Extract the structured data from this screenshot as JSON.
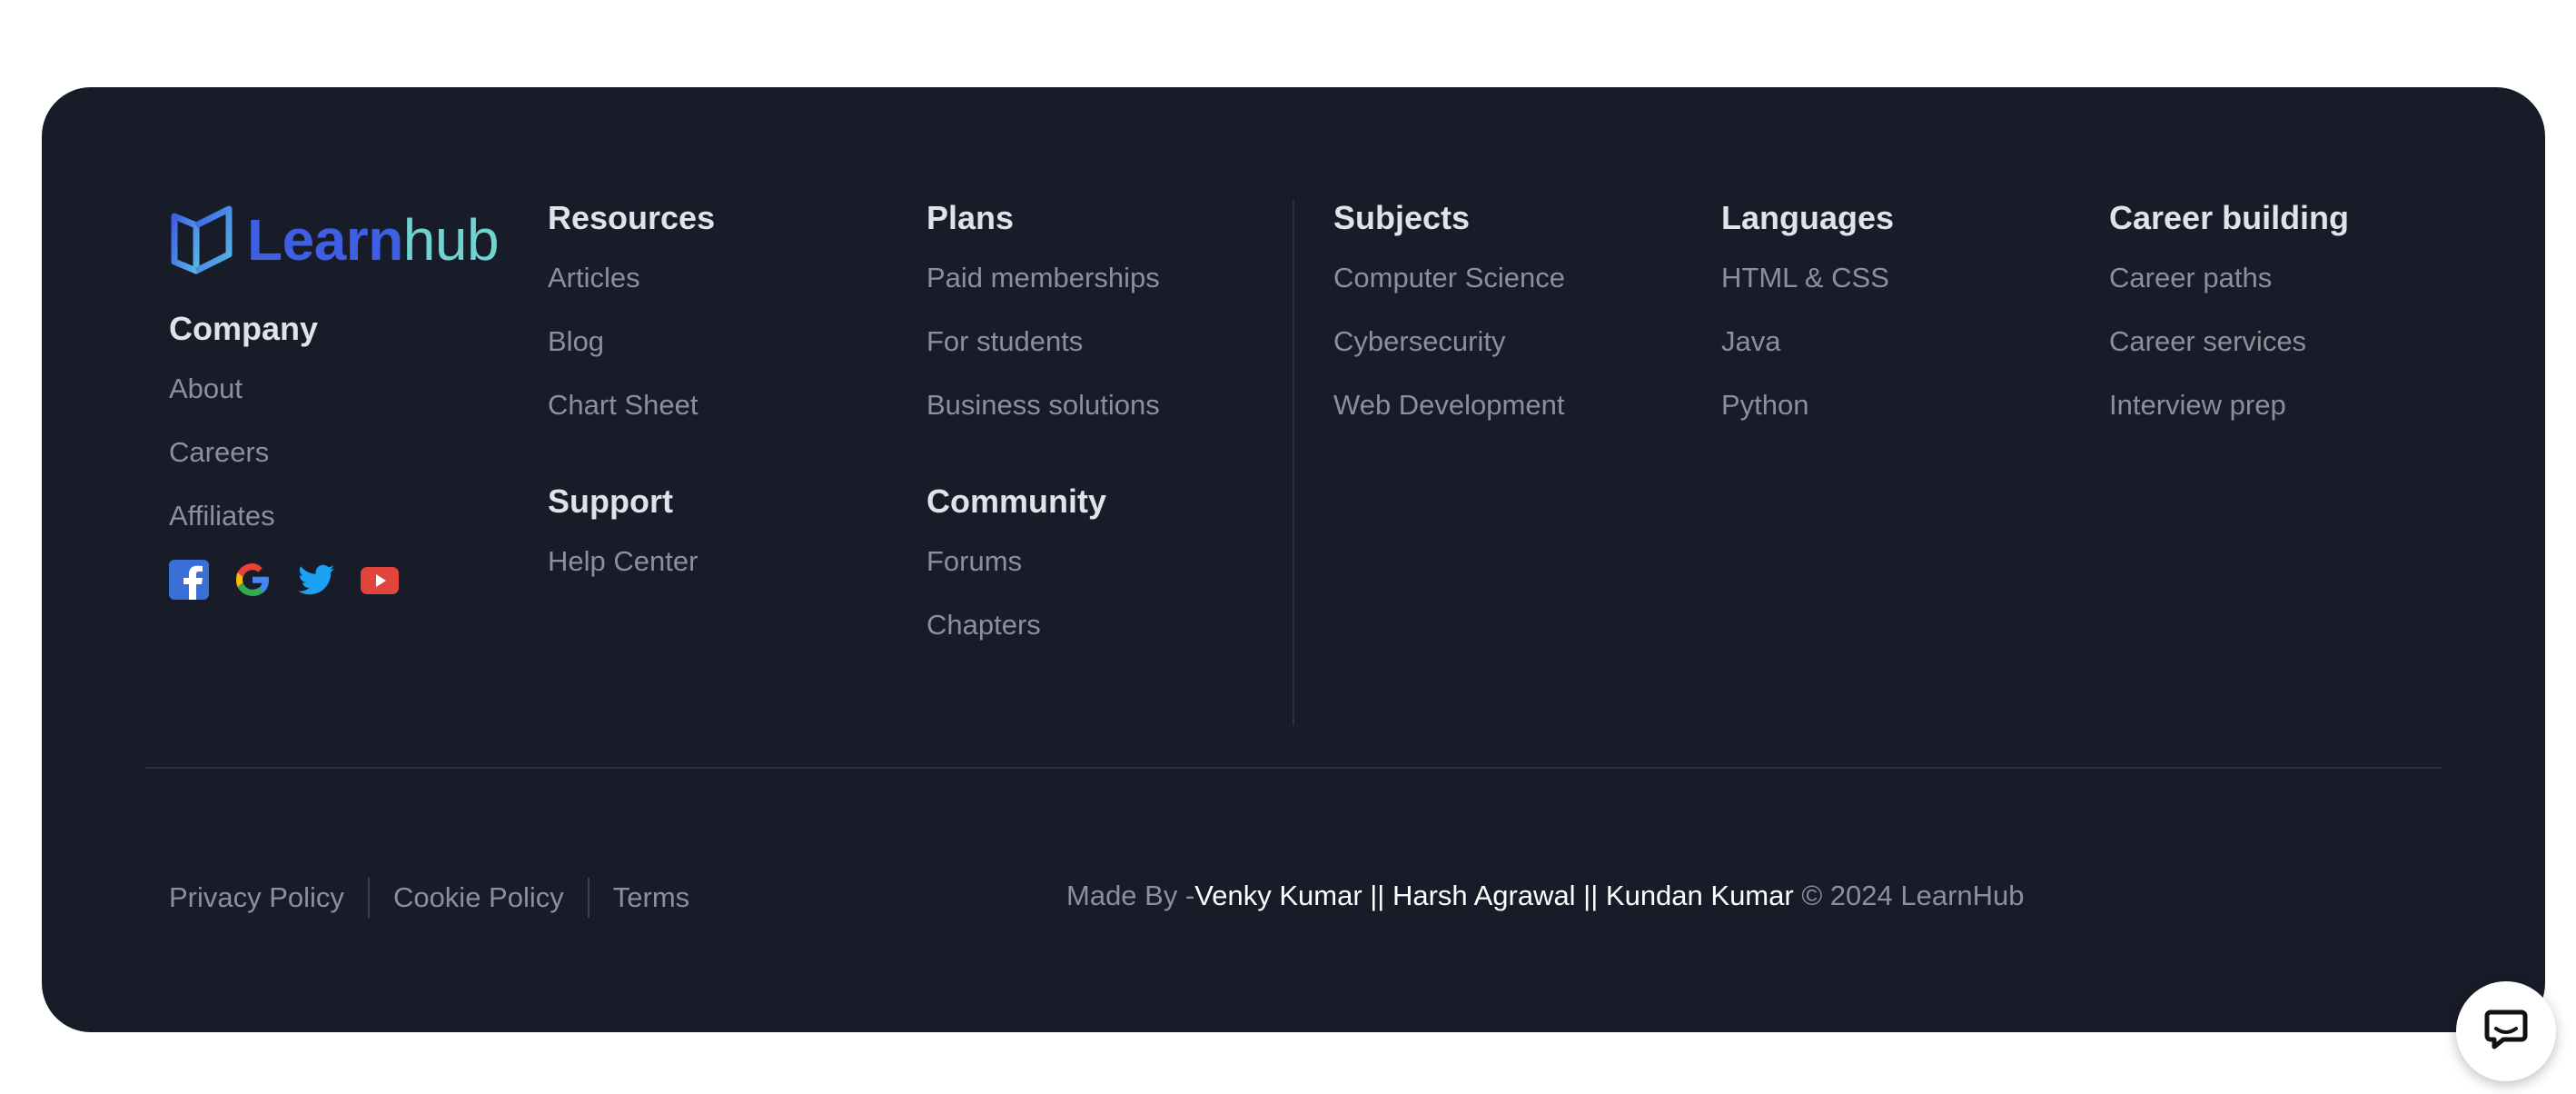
{
  "brand": {
    "learn": "Learn",
    "hub": "hub"
  },
  "columns": {
    "company": {
      "title": "Company",
      "links": [
        "About",
        "Careers",
        "Affiliates"
      ]
    },
    "resources": {
      "title": "Resources",
      "links": [
        "Articles",
        "Blog",
        "Chart Sheet"
      ]
    },
    "support": {
      "title": "Support",
      "links": [
        "Help Center"
      ]
    },
    "plans": {
      "title": "Plans",
      "links": [
        "Paid memberships",
        "For students",
        "Business solutions"
      ]
    },
    "community": {
      "title": "Community",
      "links": [
        "Forums",
        "Chapters"
      ]
    },
    "subjects": {
      "title": "Subjects",
      "links": [
        "Computer Science",
        "Cybersecurity",
        "Web Development"
      ]
    },
    "languages": {
      "title": "Languages",
      "links": [
        "HTML & CSS",
        "Java",
        "Python"
      ]
    },
    "career": {
      "title": "Career building",
      "links": [
        "Career paths",
        "Career services",
        "Interview prep"
      ]
    }
  },
  "social": [
    "facebook-icon",
    "google-icon",
    "twitter-icon",
    "youtube-icon"
  ],
  "legal": [
    "Privacy Policy",
    "Cookie Policy",
    "Terms"
  ],
  "credits": {
    "prefix": "Made By -",
    "names": "Venky Kumar || Harsh Agrawal || Kundan Kumar",
    "suffix": " © 2024 LearnHub"
  },
  "colors": {
    "footer_bg": "#171c28",
    "heading": "#dfe3ea",
    "link": "#8b909b",
    "brand_blue": "#3f5fe3",
    "brand_teal": "#6fd3d0"
  }
}
